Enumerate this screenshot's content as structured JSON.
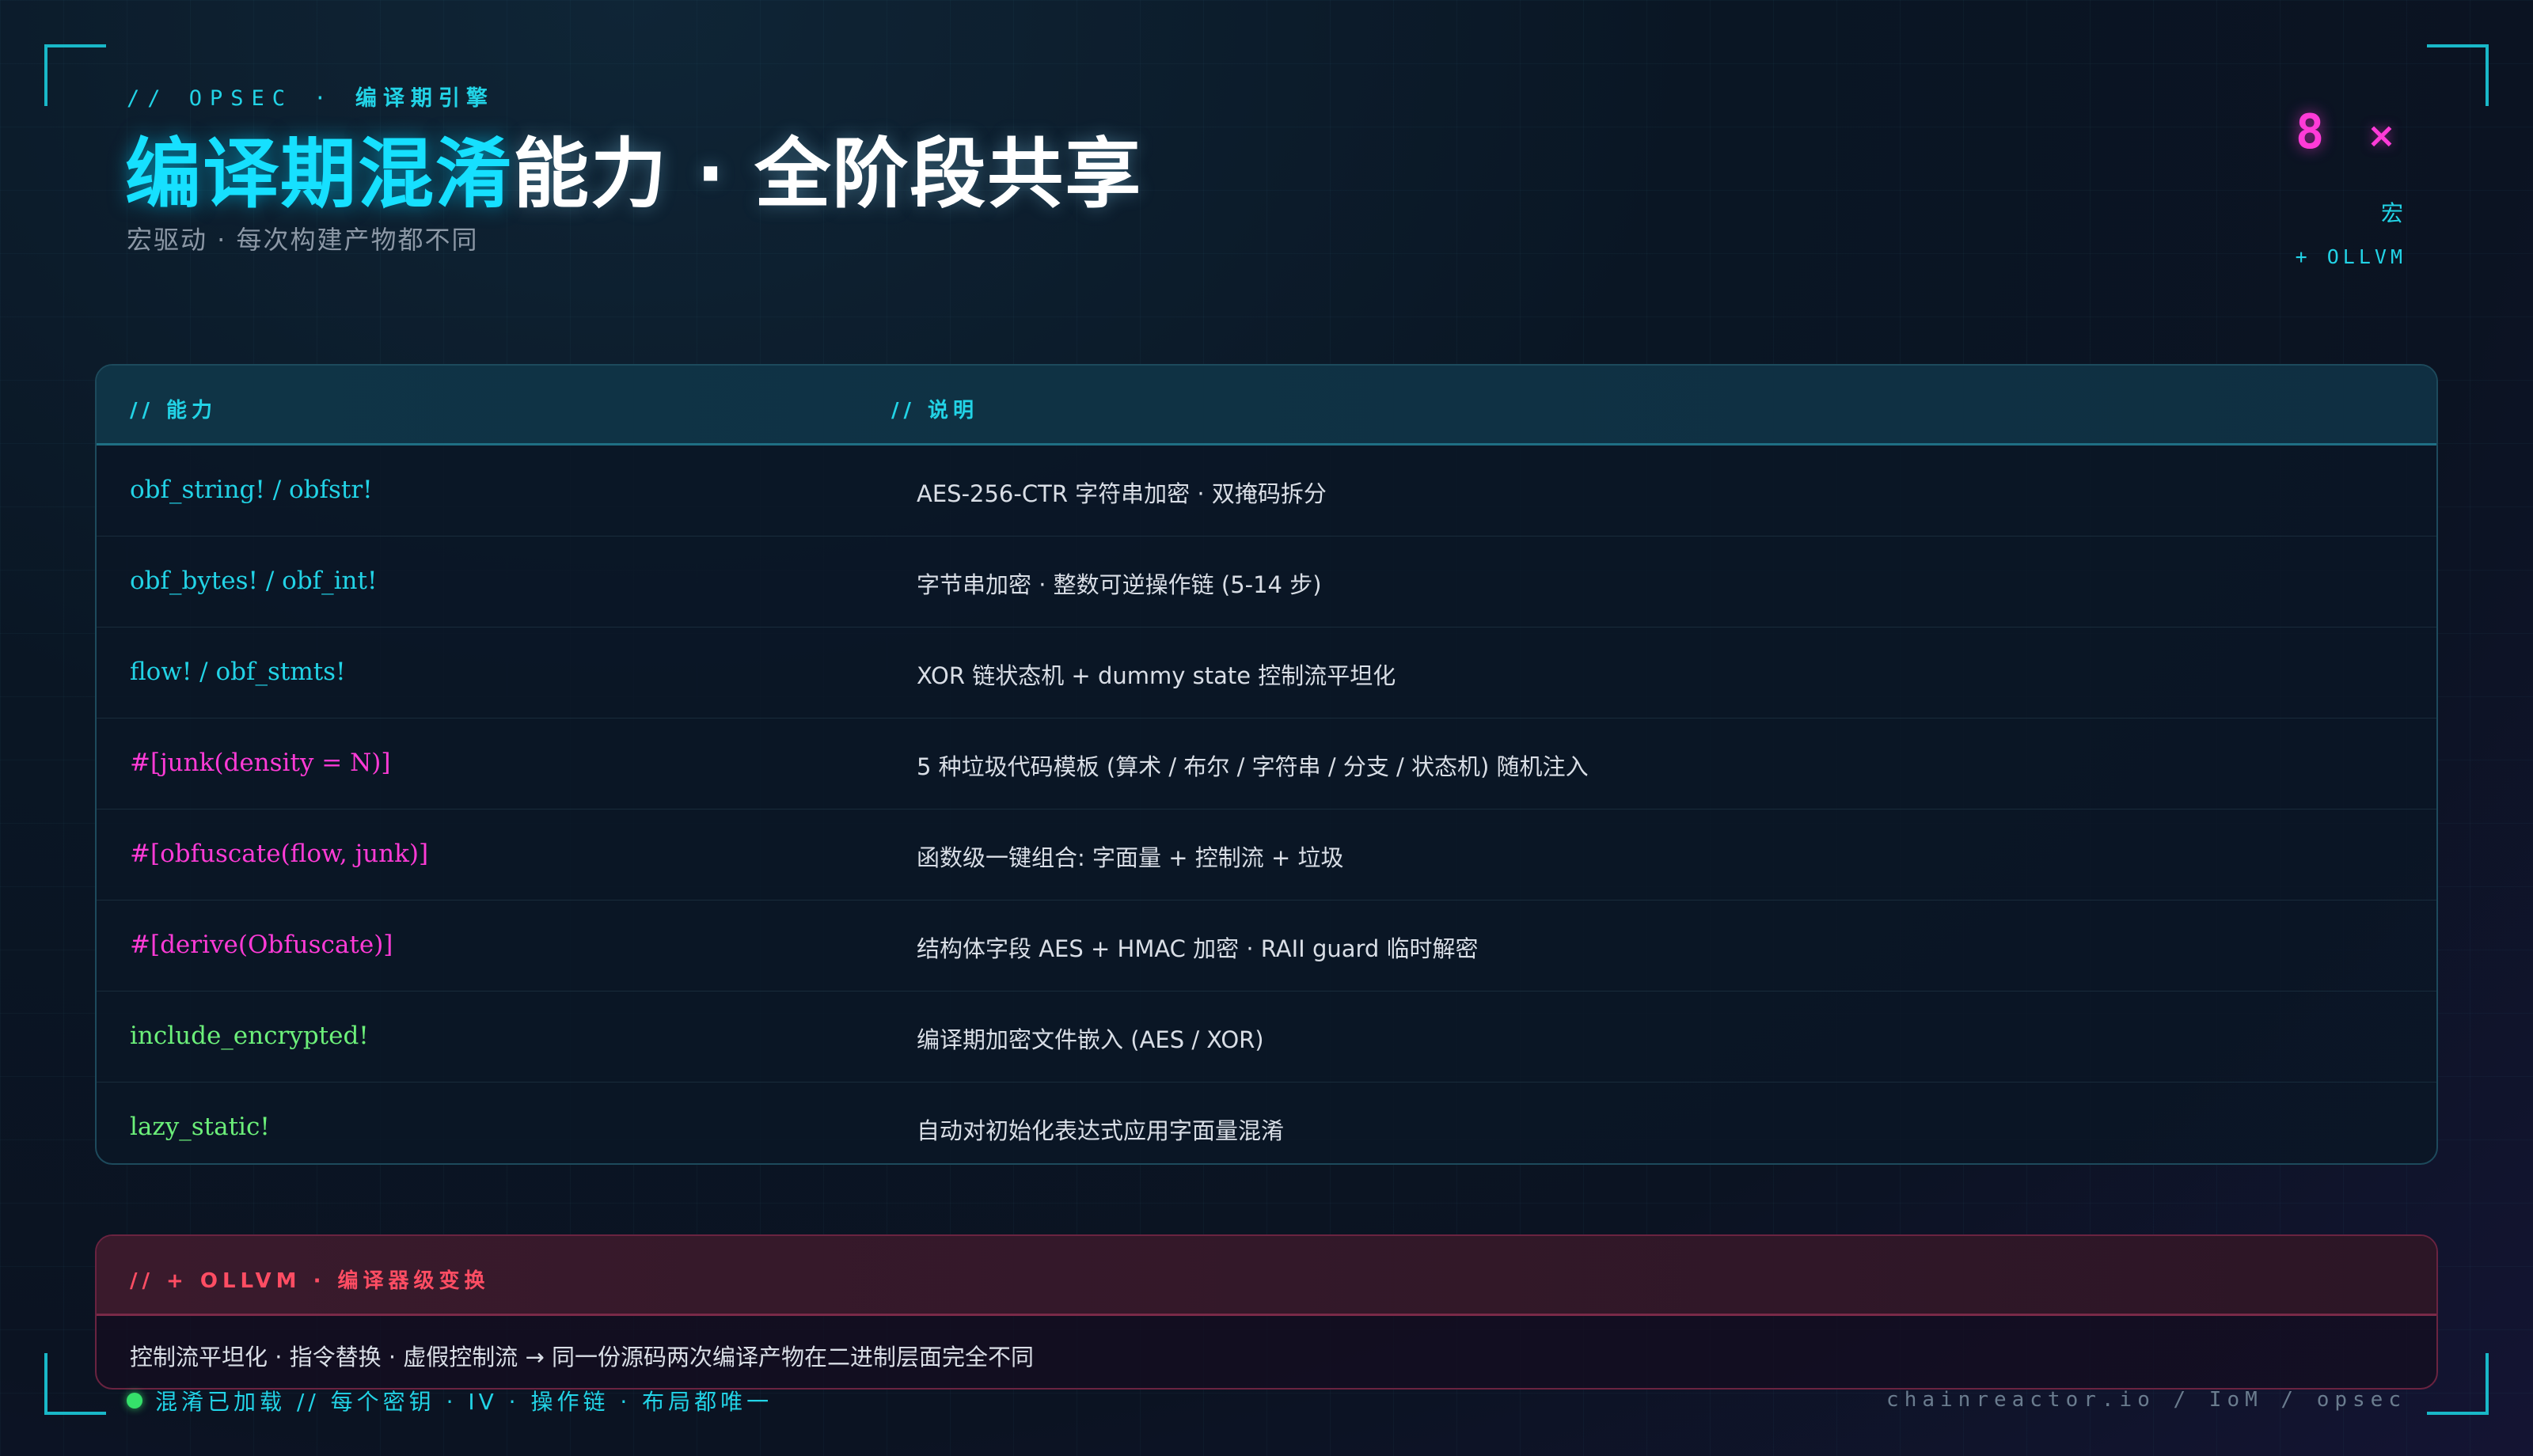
{
  "header": {
    "eyebrow_prefix": "// OPSEC ·",
    "eyebrow_cn": "编译期引擎",
    "title_highlight": "编译期混淆",
    "title_rest": "能力 · 全阶段共享",
    "subtitle": "宏驱动 · 每次构建产物都不同"
  },
  "badge": {
    "count": "8",
    "multiplier": "×",
    "unit": "宏",
    "extra": "+ OLLVM"
  },
  "table": {
    "header_capability": "// 能力",
    "header_description": "// 说明",
    "rows": [
      {
        "capability": "obf_string! / obfstr!",
        "description": "AES-256-CTR 字符串加密 · 双掩码拆分",
        "color": "#22d3e6"
      },
      {
        "capability": "obf_bytes! / obf_int!",
        "description": "字节串加密 · 整数可逆操作链 (5-14 步)",
        "color": "#22d3e6"
      },
      {
        "capability": "flow! / obf_stmts!",
        "description": "XOR 链状态机 + dummy state 控制流平坦化",
        "color": "#22d3e6"
      },
      {
        "capability": "#[junk(density = N)]",
        "description": "5 种垃圾代码模板 (算术 / 布尔 / 字符串 / 分支 / 状态机) 随机注入",
        "color": "#ff3bd7"
      },
      {
        "capability": "#[obfuscate(flow, junk)]",
        "description": "函数级一键组合: 字面量 + 控制流 + 垃圾",
        "color": "#ff3bd7"
      },
      {
        "capability": "#[derive(Obfuscate)]",
        "description": "结构体字段 AES + HMAC 加密 · RAII guard 临时解密",
        "color": "#ff3bd7"
      },
      {
        "capability": "include_encrypted!",
        "description": "编译期加密文件嵌入 (AES / XOR)",
        "color": "#6cf07a"
      },
      {
        "capability": "lazy_static!",
        "description": "自动对初始化表达式应用字面量混淆",
        "color": "#6cf07a"
      }
    ]
  },
  "ollvm": {
    "title": "// + OLLVM · 编译器级变换",
    "body": "控制流平坦化 · 指令替换 · 虚假控制流 → 同一份源码两次编译产物在二进制层面完全不同"
  },
  "footer": {
    "status": "混淆已加载 // 每个密钥 · IV · 操作链 · 布局都唯一",
    "brand": "chainreactor.io / IoM / opsec"
  },
  "colors": {
    "accent": "#22d3e6",
    "highlight": "#ff3bd7",
    "success": "#6cf07a",
    "warning": "#ff4d63"
  }
}
